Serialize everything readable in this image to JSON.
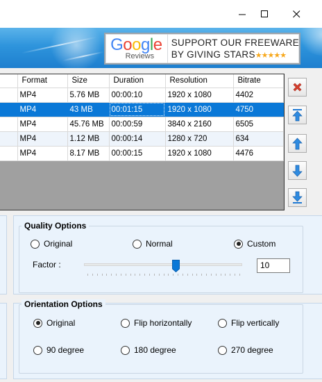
{
  "window": {
    "controls": [
      "minimize-icon",
      "maximize-icon",
      "close-icon"
    ]
  },
  "banner": {
    "badge": {
      "brand": "Google",
      "brand_sub": "Reviews",
      "line1": "SUPPORT OUR FREEWARE",
      "line2": "BY GIVING STARS",
      "stars": "★★★★★"
    }
  },
  "table": {
    "columns": [
      "Format",
      "Size",
      "Duration",
      "Resolution",
      "Bitrate"
    ],
    "rows": [
      {
        "format": "MP4",
        "size": "5.76 MB",
        "duration": "00:00:10",
        "resolution": "1920 x 1080",
        "bitrate": "4402"
      },
      {
        "format": "MP4",
        "size": "43 MB",
        "duration": "00:01:15",
        "resolution": "1920 x 1080",
        "bitrate": "4750"
      },
      {
        "format": "MP4",
        "size": "45.76 MB",
        "duration": "00:00:59",
        "resolution": "3840 x 2160",
        "bitrate": "6505"
      },
      {
        "format": "MP4",
        "size": "1.12 MB",
        "duration": "00:00:14",
        "resolution": "1280 x 720",
        "bitrate": "634"
      },
      {
        "format": "MP4",
        "size": "8.17 MB",
        "duration": "00:00:15",
        "resolution": "1920 x 1080",
        "bitrate": "4476"
      }
    ],
    "selected_row": 2
  },
  "side_buttons": [
    "delete-icon",
    "move-top-icon",
    "move-up-icon",
    "move-down-icon",
    "move-bottom-icon"
  ],
  "quality": {
    "title": "Quality Options",
    "options": [
      "Original",
      "Normal",
      "Custom"
    ],
    "selected": "Custom",
    "factor_label": "Factor :",
    "factor_value": "10",
    "slider_fraction": 0.58
  },
  "orientation": {
    "title": "Orientation Options",
    "options": [
      "Original",
      "Flip horizontally",
      "Flip vertically",
      "90 degree",
      "180 degree",
      "270 degree"
    ],
    "selected": "Original"
  },
  "colors": {
    "selection": "#0a78d7",
    "banner": "#2e94dc",
    "delete": "#d6402f",
    "arrow": "#1e79d4"
  }
}
